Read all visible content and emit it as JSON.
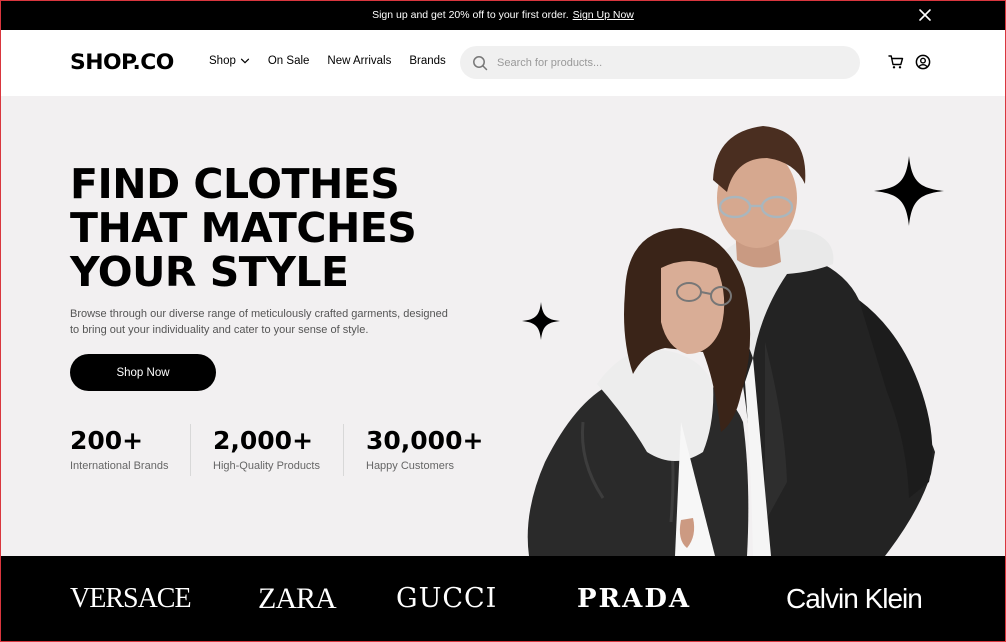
{
  "promo": {
    "text": "Sign up and get 20% off to your first order.",
    "link": "Sign Up Now"
  },
  "header": {
    "logo": "SHOP.CO",
    "nav": [
      {
        "label": "Shop"
      },
      {
        "label": "On Sale"
      },
      {
        "label": "New Arrivals"
      },
      {
        "label": "Brands"
      }
    ],
    "search_placeholder": "Search for products...",
    "icons": [
      "search-icon",
      "cart-icon",
      "account-icon"
    ]
  },
  "hero": {
    "title_lines": [
      "FIND CLOTHES",
      "THAT MATCHES",
      "YOUR STYLE"
    ],
    "description": "Browse through our diverse range of meticulously crafted garments, designed to bring out your individuality and cater to your sense of style.",
    "cta": "Shop Now",
    "stats": [
      {
        "value": "200+",
        "label": "International Brands"
      },
      {
        "value": "2,000+",
        "label": "High-Quality Products"
      },
      {
        "value": "30,000+",
        "label": "Happy Customers"
      }
    ]
  },
  "brands": [
    "VERSACE",
    "ZARA",
    "GUCCI",
    "PRADA",
    "Calvin Klein"
  ],
  "colors": {
    "accent": "#000000",
    "hero_bg": "#f2f0f1",
    "search_bg": "#f0f0f0",
    "text_muted": "#666666"
  }
}
